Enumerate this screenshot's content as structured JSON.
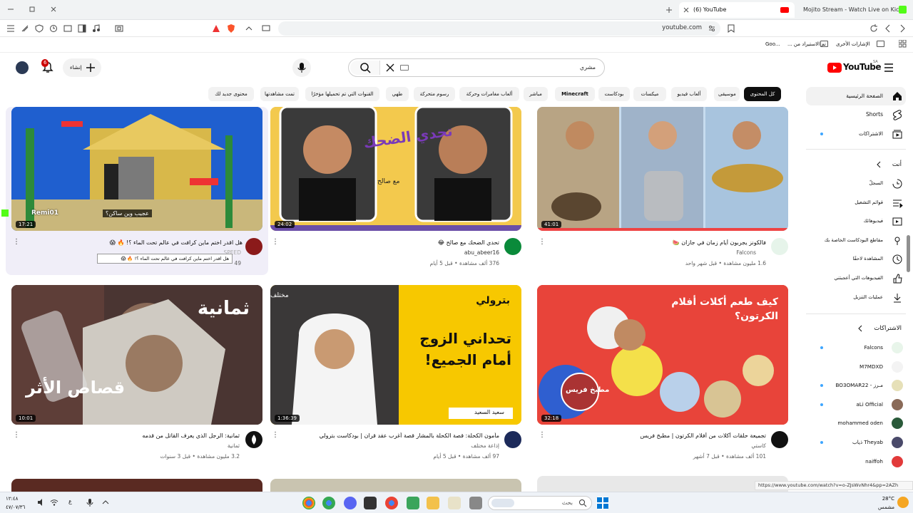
{
  "browser": {
    "tabs": [
      {
        "title": "(6) YouTube"
      },
      {
        "title": "Mojito Stream - Watch Live on Kick"
      }
    ],
    "url": "youtube.com",
    "bookmarks": {
      "other": "الإشارات الأخرى",
      "imported": "تم الاستيراد من ...",
      "goo": "Goo..."
    }
  },
  "youtube": {
    "logo": "YouTube",
    "region": "SA",
    "search_value": "مشري",
    "create_label": "إنشاء",
    "notif_count": "6",
    "chips": [
      "كل المحتوى",
      "موسيقى",
      "ألعاب فيديو",
      "ميكسات",
      "بودكاست",
      "Minecraft",
      "مباشر",
      "ألعاب مغامرات وحركة",
      "رسوم متحركة",
      "طهي",
      "القنوات التي تم تحميلها مؤخرًا",
      "تمت مشاهدتها",
      "محتوى جديد لك"
    ],
    "sidebar": {
      "main": [
        "الصفحة الرئيسية",
        "Shorts",
        "الاشتراكات"
      ],
      "you_header": "أنت",
      "you": [
        "السجلّ",
        "قوائم التشغيل",
        "فيديوهاتك",
        "مقاطع البودكاست الخاصة بك",
        "المشاهدة لاحقًا",
        "الفيديوهات التي أعجبتني",
        "عمليات التنزيل"
      ],
      "subs_header": "الاشتراكات",
      "subs": [
        "Falcons",
        "M7MDXD",
        "مـرز - BO3OMAR22",
        "aLi Official",
        "mohammed oden",
        "Theyab ذياب",
        "naiffoh"
      ]
    },
    "videos": [
      {
        "title": "هل اقدر اختم ماين كرافت في عالم تحت الماء ؟! 🔥 😱",
        "channel": "SPEED",
        "meta": "49",
        "duration": "17:21",
        "overlay": "عجيب وين ساكن؟",
        "overlay2": "Remi01",
        "tooltip": "هل اقدر اختم ماين كرافت في عالم تحت الماء ؟! 🔥 😱"
      },
      {
        "title": "تحدي الضحك مع صالح 😂",
        "channel": "abu_abeer16",
        "meta": "376 ألف مشاهدة • قبل 5 أيام",
        "duration": "24:02",
        "thumb_text": "تحدي الضحك",
        "thumb_sub": "مع صالح"
      },
      {
        "title": "فالكونز يجربون أيام زمان في جازان 🍉",
        "channel": "Falcons",
        "meta": "1.6 مليون مشاهدة • قبل شهر واحد",
        "duration": "41:01"
      },
      {
        "title": "ثمانية: الرجل الذي يعرف القاتل من قدمه",
        "channel": "ثمانية",
        "meta": "3.2 مليون مشاهدة • قبل 3 سنوات",
        "duration": "10:01",
        "thumb_text": "ثمانية",
        "thumb_sub": "قصاص الأثر"
      },
      {
        "title": "مأمون الكحلة: قصة الكحلة بالمشار قصة أغرب عقد قران | بودكاست بترولي",
        "channel": "إذاعة مختلف",
        "meta": "97 ألف مشاهدة • قبل 5 أيام",
        "duration": "1:36:39",
        "thumb_text": "تحداني الزوج أمام الجميع!",
        "thumb_sub": "سعيد السعيد",
        "thumb_brand": "بترولي",
        "thumb_tag": "مختلف"
      },
      {
        "title": "تجميعة حلقات أكلات من أفلام الكرتون | مطبخ فريس",
        "channel": "كاستي",
        "meta": "101 ألف مشاهدة • قبل 7 أشهر",
        "duration": "32:18",
        "thumb_text": "كيف طعم أكلات أفلام الكرتون؟",
        "thumb_sub": "مطبخ فريس"
      }
    ],
    "status_url": "https://www.youtube.com/watch?v=o-ZJsWvNhr4&pp=2AZh"
  },
  "taskbar": {
    "weather_temp": "28°C",
    "weather_desc": "مشمس",
    "time": "١٢:٤٨",
    "date": "٤٧/٠٧/٣٦",
    "lang": "ع",
    "search_placeholder": "بحث"
  },
  "colors": {
    "yt_red": "#ff0000",
    "chip_active": "#0f0f0f"
  }
}
